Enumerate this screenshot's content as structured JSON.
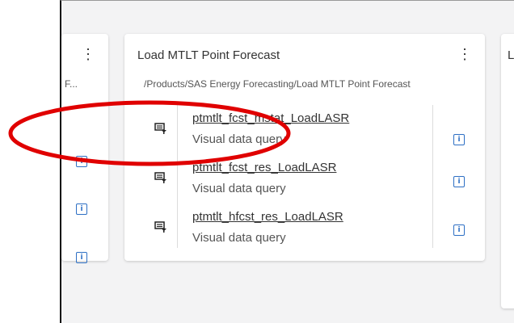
{
  "left_card": {
    "truncated_text": "F..."
  },
  "main_card": {
    "title": "Load MTLT Point Forecast",
    "path": "/Products/SAS Energy Forecasting/Load MTLT Point Forecast",
    "items": [
      {
        "name": "ptmtlt_fcst_mstat_LoadLASR",
        "type": "Visual data query"
      },
      {
        "name": "ptmtlt_fcst_res_LoadLASR",
        "type": "Visual data query"
      },
      {
        "name": "ptmtlt_hfcst_res_LoadLASR",
        "type": "Visual data query"
      }
    ]
  },
  "right_card": {
    "title_fragment": "L"
  },
  "icons": {
    "kebab": "more-vertical-icon",
    "info": "info-icon",
    "query": "visual-data-query-icon"
  },
  "annotation": {
    "color": "#e00000"
  },
  "info_glyph": "i",
  "kebab_glyph": "⋮"
}
